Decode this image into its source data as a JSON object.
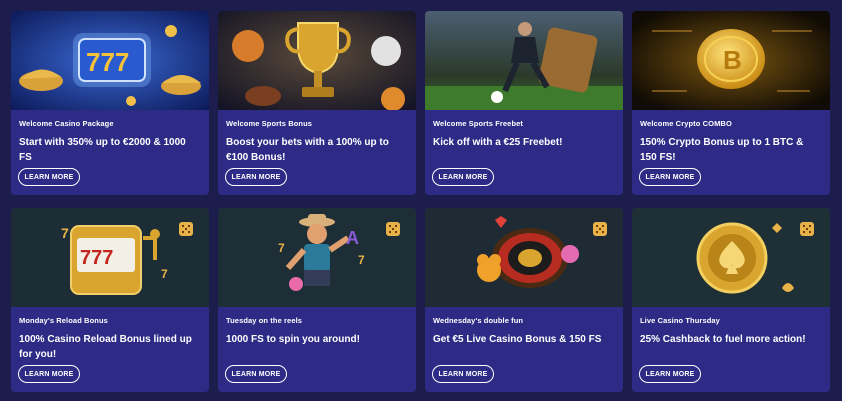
{
  "promotions": [
    {
      "category": "Welcome Casino Package",
      "headline": "Start with 350% up to €2000 & 1000 FS",
      "cta": "LEARN MORE",
      "image_icon": "slot-777-genie-lamps-icon"
    },
    {
      "category": "Welcome Sports Bonus",
      "headline": "Boost your bets with a 100% up to €100 Bonus!",
      "cta": "LEARN MORE",
      "image_icon": "trophy-balls-icon"
    },
    {
      "category": "Welcome Sports Freebet",
      "headline": "Kick off with a €25 Freebet!",
      "cta": "LEARN MORE",
      "image_icon": "football-player-icon"
    },
    {
      "category": "Welcome Crypto COMBO",
      "headline": "150% Crypto Bonus up to 1 BTC & 150 FS!",
      "cta": "LEARN MORE",
      "image_icon": "bitcoin-coin-icon"
    },
    {
      "category": "Monday's Reload Bonus",
      "headline": "100% Casino Reload Bonus lined up for you!",
      "cta": "LEARN MORE",
      "image_icon": "golden-slot-machine-icon"
    },
    {
      "category": "Tuesday on the reels",
      "headline": "1000 FS to spin you around!",
      "cta": "LEARN MORE",
      "image_icon": "cowboy-character-icon"
    },
    {
      "category": "Wednesday's double fun",
      "headline": "Get €5 Live Casino Bonus & 150 FS",
      "cta": "LEARN MORE",
      "image_icon": "roulette-wheel-icon"
    },
    {
      "category": "Live Casino Thursday",
      "headline": "25% Cashback to fuel more action!",
      "cta": "LEARN MORE",
      "image_icon": "spade-chip-icon"
    }
  ],
  "colors": {
    "page_bg": "#1c1c4d",
    "card_bg": "#2d2b86",
    "text": "#ffffff",
    "gold": "#e7b247"
  }
}
